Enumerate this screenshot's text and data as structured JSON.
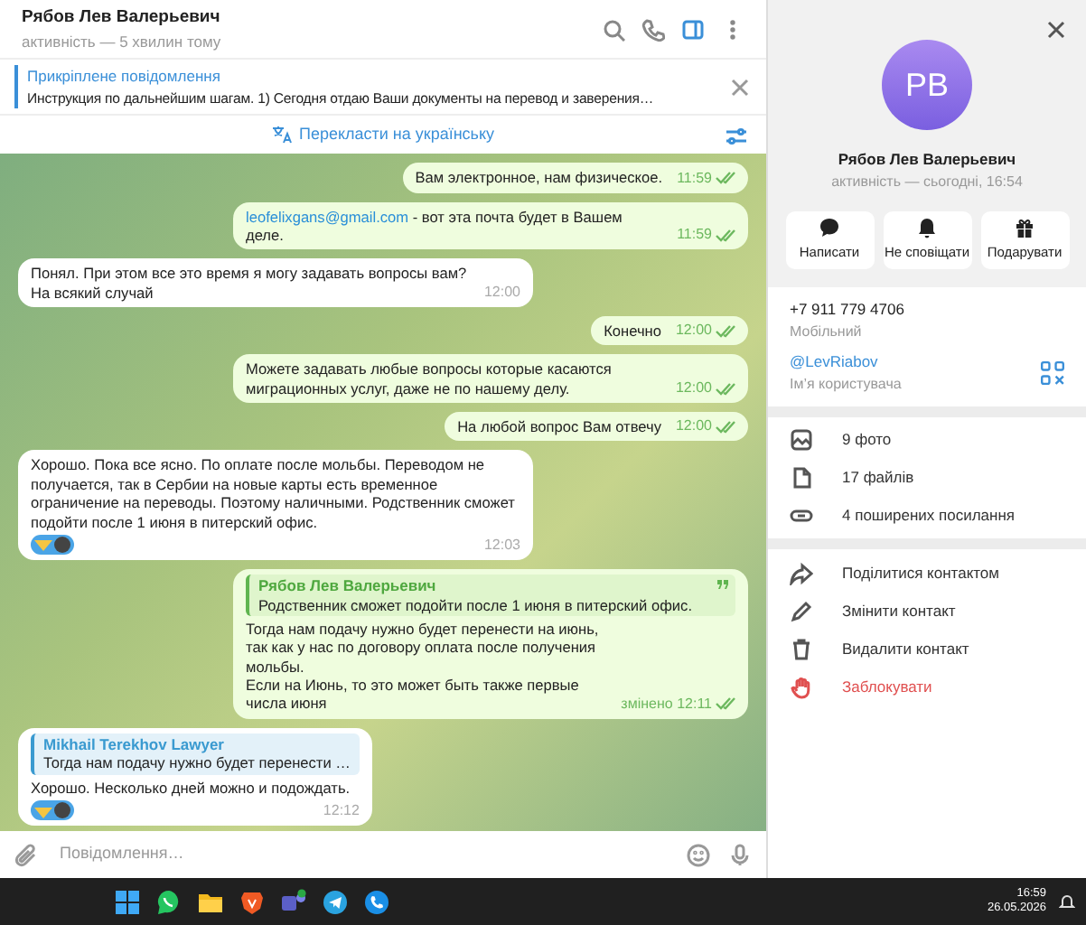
{
  "chat_header": {
    "name": "Рябов Лев Валерьевич",
    "status": "активність — 5 хвилин тому",
    "sidebar_open": true
  },
  "pinned": {
    "title": "Прикріплене повідомлення",
    "text": "Инструкция по дальнейшим шагам.  1) Сегодня отдаю Ваши документы на перевод и заверения…"
  },
  "translate_bar": {
    "label": "Перекласти на українську"
  },
  "messages": [
    {
      "outgoing": true,
      "text": "Вам электронное, нам физическое.",
      "time": "11:59",
      "read": true
    },
    {
      "outgoing": true,
      "link": "leofelixgans@gmail.com",
      "text": " - вот эта почта будет в Вашем деле.",
      "time": "11:59",
      "read": true
    },
    {
      "outgoing": false,
      "text": "Понял. При этом все это время я могу задавать вопросы вам? На всякий случай",
      "time": "12:00"
    },
    {
      "outgoing": true,
      "text": "Конечно",
      "time": "12:00",
      "read": true
    },
    {
      "outgoing": true,
      "text": "Можете задавать любые вопросы которые касаются миграционных услуг, даже не по нашему делу.",
      "time": "12:00",
      "read": true
    },
    {
      "outgoing": true,
      "text": "На любой вопрос Вам отвечу",
      "time": "12:00",
      "read": true
    },
    {
      "outgoing": false,
      "text": "Хорошо. Пока все ясно. По оплате после мольбы. Переводом не получается, так в Сербии на новые карты есть временное ограничение на переводы. Поэтому наличными. Родственник сможет подойти после 1 июня в питерский офис.",
      "time": "12:03",
      "reaction": true
    },
    {
      "outgoing": true,
      "reply": {
        "author": "Рябов Лев Валерьевич",
        "text": "Родственник сможет подойти после 1 июня в питерский офис."
      },
      "text": "Тогда нам подачу нужно будет перенести на июнь, так как у нас по договору оплата после получения мольбы.\nЕсли на Июнь, то это может быть также первые числа июня",
      "edited": "змінено",
      "time": "12:11",
      "read": true
    },
    {
      "outgoing": false,
      "reply": {
        "author": "Mikhail Terekhov Lawyer",
        "text": "Тогда нам подачу нужно будет перенести …"
      },
      "text": "Хорошо. Несколько дней можно и подождать.",
      "time": "12:12",
      "reaction": true
    }
  ],
  "composer": {
    "placeholder": "Повідомлення…"
  },
  "profile": {
    "initials": "РВ",
    "name": "Рябов Лев Валерьевич",
    "status": "активність — сьогодні, 16:54",
    "actions": [
      {
        "kind": "message",
        "label": "Написати"
      },
      {
        "kind": "mute",
        "label": "Не сповіщати"
      },
      {
        "kind": "gift",
        "label": "Подарувати"
      }
    ],
    "phone": {
      "value": "+7 911 779 4706",
      "label": "Мобільний"
    },
    "username": {
      "value": "@LevRiabov",
      "label": "Ім’я користувача"
    },
    "media": [
      {
        "kind": "photo",
        "label": "9 фото"
      },
      {
        "kind": "file",
        "label": "17 файлів"
      },
      {
        "kind": "link",
        "label": "4 поширених посилання"
      }
    ],
    "menu": [
      {
        "kind": "share",
        "label": "Поділитися контактом",
        "danger": false
      },
      {
        "kind": "edit",
        "label": "Змінити контакт",
        "danger": false
      },
      {
        "kind": "delete",
        "label": "Видалити контакт",
        "danger": false
      },
      {
        "kind": "block",
        "label": "Заблокувати",
        "danger": true
      }
    ]
  },
  "taskbar": {
    "apps": [
      {
        "kind": "start"
      },
      {
        "kind": "chat"
      },
      {
        "kind": "folder"
      },
      {
        "kind": "browser"
      },
      {
        "kind": "team"
      },
      {
        "kind": "plane"
      },
      {
        "kind": "phone"
      }
    ],
    "time": "16:59",
    "date": "26.05.2026"
  }
}
